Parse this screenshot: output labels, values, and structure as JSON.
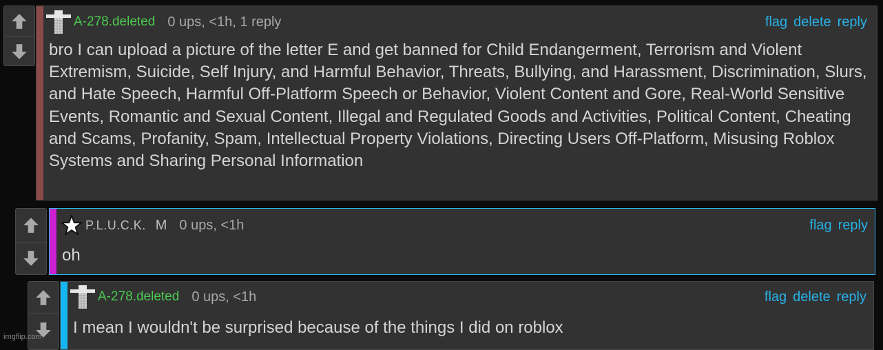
{
  "watermark": "imgflip.com",
  "icons": {
    "vote_up": "arrow-up-icon",
    "vote_down": "arrow-down-icon",
    "avatar_blocks": "block-figure-icon",
    "avatar_star": "star-icon"
  },
  "colors": {
    "accent_link": "#27b1e6",
    "username_green": "#4ccb50",
    "depth1": "#8b4a4a",
    "depth2": "#cc1fd1",
    "depth3": "#14b5f0",
    "reply_border": "#2fb6e8"
  },
  "comments": [
    {
      "username": "A-278.deleted",
      "meta": "0 ups, <1h, 1 reply",
      "actions": [
        "flag",
        "delete",
        "reply"
      ],
      "text": "bro I can upload a picture of the letter E and get banned for Child Endangerment, Terrorism and Violent Extremism, Suicide, Self Injury, and Harmful Behavior, Threats, Bullying, and Harassment, Discrimination, Slurs, and Hate Speech, Harmful Off-Platform Speech or Behavior, Violent Content and Gore, Real-World Sensitive Events, Romantic and Sexual Content, Illegal and Regulated Goods and Activities, Political Content, Cheating and Scams, Profanity, Spam, Intellectual Property Violations, Directing Users Off-Platform, Misusing Roblox Systems and Sharing Personal Information"
    },
    {
      "username": "P.L.U.C.K.",
      "badge": "M",
      "meta": "0 ups, <1h",
      "actions": [
        "flag",
        "reply"
      ],
      "text": "oh"
    },
    {
      "username": "A-278.deleted",
      "meta": "0 ups, <1h",
      "actions": [
        "flag",
        "delete",
        "reply"
      ],
      "text": "I mean I wouldn't be surprised because of the things I did on roblox"
    }
  ]
}
